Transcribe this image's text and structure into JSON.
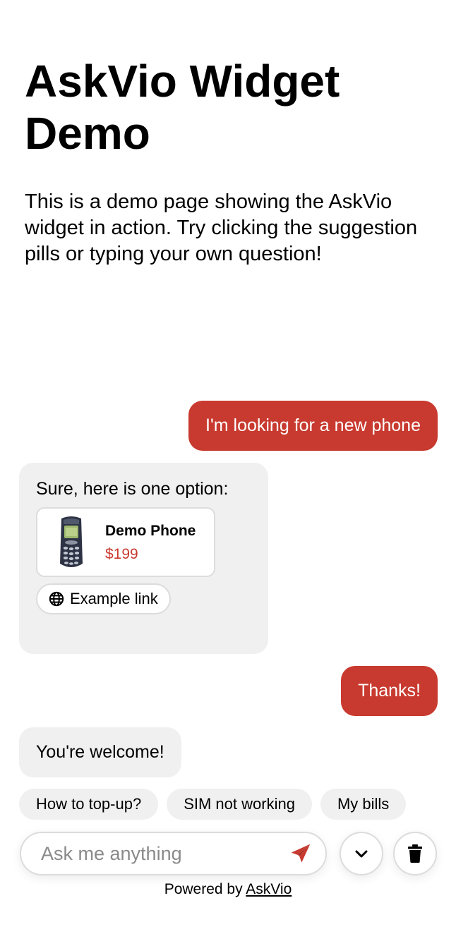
{
  "page": {
    "title": "AskVio Widget Demo",
    "intro": "This is a demo page showing the AskVio widget in action. Try clicking the suggestion pills or typing your own question!"
  },
  "chat": {
    "messages": [
      {
        "role": "user",
        "text": "I'm looking for a new phone"
      },
      {
        "role": "assistant",
        "text": "Sure, here is one option:"
      },
      {
        "role": "user",
        "text": "Thanks!"
      },
      {
        "role": "assistant",
        "text": "You're welcome!"
      }
    ],
    "product": {
      "name": "Demo Phone",
      "price": "$199",
      "image_icon": "feature-phone-image"
    },
    "link": {
      "label": "Example link",
      "icon": "globe-icon"
    }
  },
  "suggestions": [
    "How to top-up?",
    "SIM not working",
    "My bills"
  ],
  "input": {
    "placeholder": "Ask me anything",
    "value": ""
  },
  "controls": {
    "send_icon": "send-icon",
    "collapse_icon": "chevron-down-icon",
    "clear_icon": "trash-icon"
  },
  "footer": {
    "prefix": "Powered by",
    "brand": "AskVio"
  },
  "colors": {
    "accent": "#c83a2f",
    "bot_bubble": "#f0f0f0",
    "border": "#dcdcdc"
  }
}
